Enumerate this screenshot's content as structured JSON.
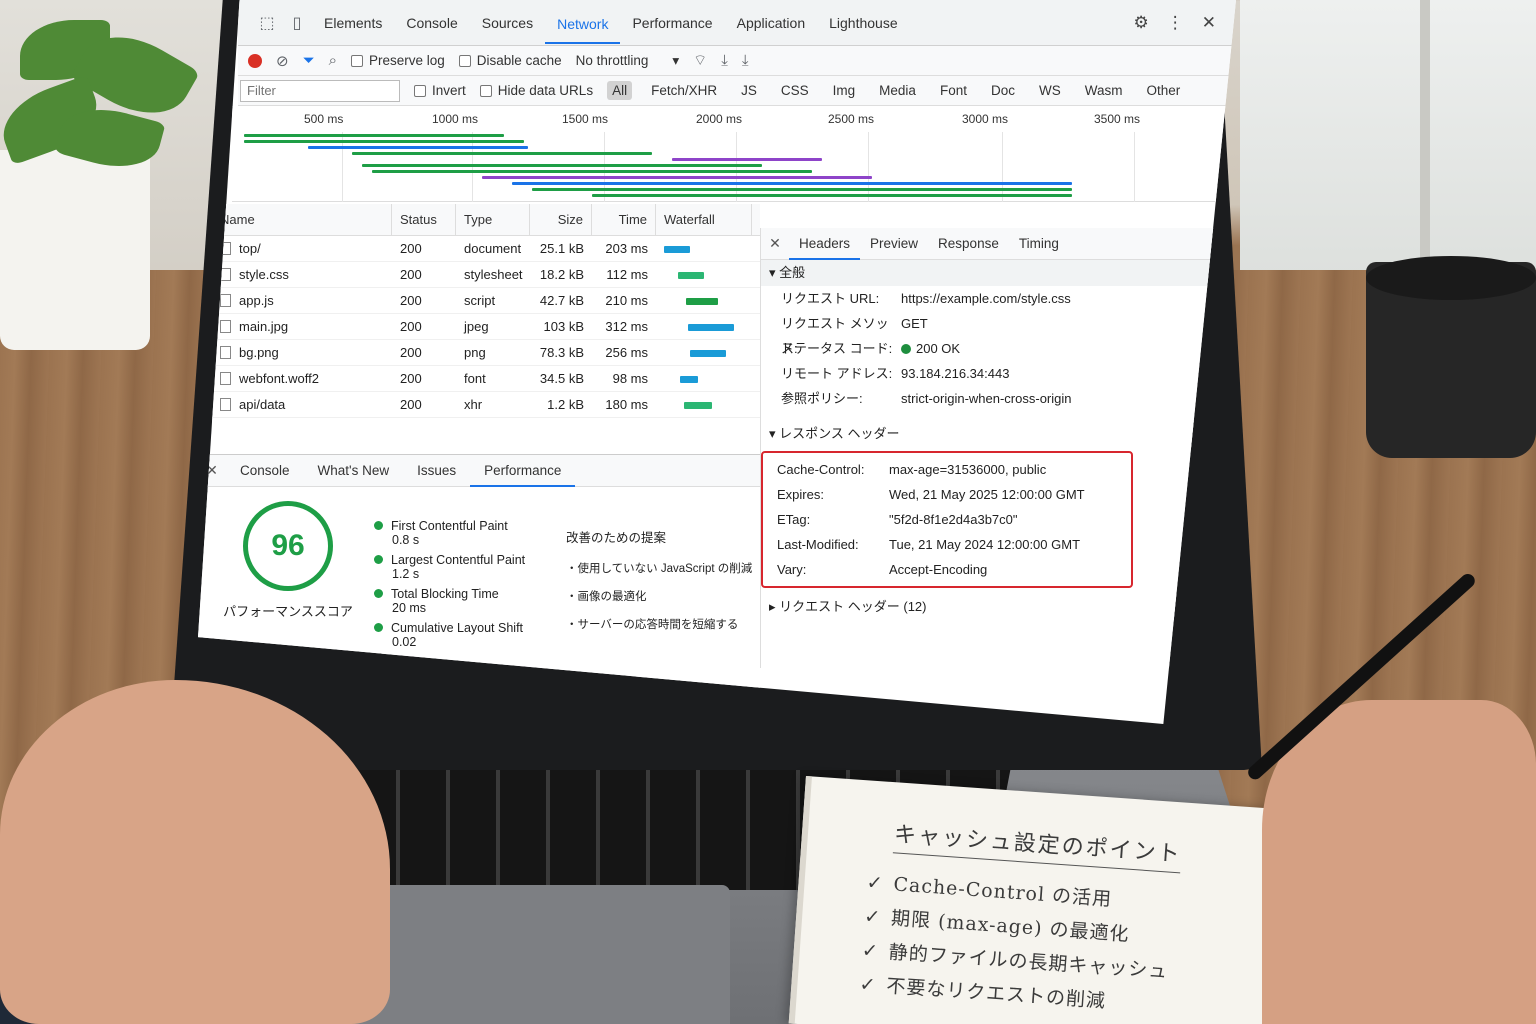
{
  "devtools": {
    "tabs": [
      "Elements",
      "Console",
      "Sources",
      "Network",
      "Performance",
      "Application",
      "Lighthouse"
    ],
    "active_tab": "Network",
    "toolbar": {
      "preserve_log": "Preserve log",
      "disable_cache": "Disable cache",
      "throttling": "No throttling"
    },
    "filter": {
      "placeholder": "Filter",
      "invert": "Invert",
      "hide_data_urls": "Hide data URLs",
      "types": [
        "All",
        "Fetch/XHR",
        "JS",
        "CSS",
        "Img",
        "Media",
        "Font",
        "Doc",
        "WS",
        "Wasm",
        "Other"
      ]
    },
    "overview": {
      "ticks": [
        "500 ms",
        "1000 ms",
        "1500 ms",
        "2000 ms",
        "2500 ms",
        "3000 ms",
        "3500 ms"
      ]
    },
    "table": {
      "headers": [
        "Name",
        "Status",
        "Type",
        "Size",
        "Time",
        "Waterfall"
      ],
      "rows": [
        {
          "name": "top/",
          "status": "200",
          "type": "document",
          "size": "25.1 kB",
          "time": "203 ms"
        },
        {
          "name": "style.css",
          "status": "200",
          "type": "stylesheet",
          "size": "18.2 kB",
          "time": "112 ms"
        },
        {
          "name": "app.js",
          "status": "200",
          "type": "script",
          "size": "42.7 kB",
          "time": "210 ms"
        },
        {
          "name": "main.jpg",
          "status": "200",
          "type": "jpeg",
          "size": "103 kB",
          "time": "312 ms"
        },
        {
          "name": "bg.png",
          "status": "200",
          "type": "png",
          "size": "78.3 kB",
          "time": "256 ms"
        },
        {
          "name": "webfont.woff2",
          "status": "200",
          "type": "font",
          "size": "34.5 kB",
          "time": "98 ms"
        },
        {
          "name": "api/data",
          "status": "200",
          "type": "xhr",
          "size": "1.2 kB",
          "time": "180 ms"
        }
      ]
    },
    "details": {
      "tabs": [
        "Headers",
        "Preview",
        "Response",
        "Timing"
      ],
      "active_tab": "Headers",
      "general_title": "全般",
      "general": [
        {
          "k": "リクエスト URL:",
          "v": "https://example.com/style.css"
        },
        {
          "k": "リクエスト メソッド:",
          "v": "GET"
        },
        {
          "k": "ステータス コード:",
          "v": "200 OK"
        },
        {
          "k": "リモート アドレス:",
          "v": "93.184.216.34:443"
        },
        {
          "k": "参照ポリシー:",
          "v": "strict-origin-when-cross-origin"
        }
      ],
      "response_title": "レスポンス ヘッダー",
      "response": [
        {
          "k": "Cache-Control:",
          "v": "max-age=31536000, public"
        },
        {
          "k": "Expires:",
          "v": "Wed, 21 May 2025 12:00:00 GMT"
        },
        {
          "k": "ETag:",
          "v": "\"5f2d-8f1e2d4a3b7c0\""
        },
        {
          "k": "Last-Modified:",
          "v": "Tue, 21 May 2024 12:00:00 GMT"
        },
        {
          "k": "Vary:",
          "v": "Accept-Encoding"
        }
      ],
      "request_title": "リクエスト ヘッダー (12)"
    },
    "drawer": {
      "tabs": [
        "Console",
        "What's New",
        "Issues",
        "Performance"
      ],
      "active_tab": "Performance",
      "score": "96",
      "score_label": "パフォーマンススコア",
      "metrics": [
        {
          "label": "First Contentful Paint",
          "value": "0.8 s"
        },
        {
          "label": "Largest Contentful Paint",
          "value": "1.2 s"
        },
        {
          "label": "Total Blocking Time",
          "value": "20 ms"
        },
        {
          "label": "Cumulative Layout Shift",
          "value": "0.02"
        }
      ],
      "suggest_title": "改善のための提案",
      "suggestions": [
        "・使用していない JavaScript の削減",
        "・画像の最適化",
        "・サーバーの応答時間を短縮する"
      ]
    }
  },
  "notebook": {
    "title": "キャッシュ設定のポイント",
    "items": [
      "Cache-Control の活用",
      "期限 (max-age) の最適化",
      "静的ファイルの長期キャッシュ",
      "不要なリクエストの削減"
    ]
  },
  "colors": {
    "accent": "#1a73e8",
    "record": "#d93025",
    "success": "#1e9e46",
    "highlight_box": "#d7262e"
  }
}
